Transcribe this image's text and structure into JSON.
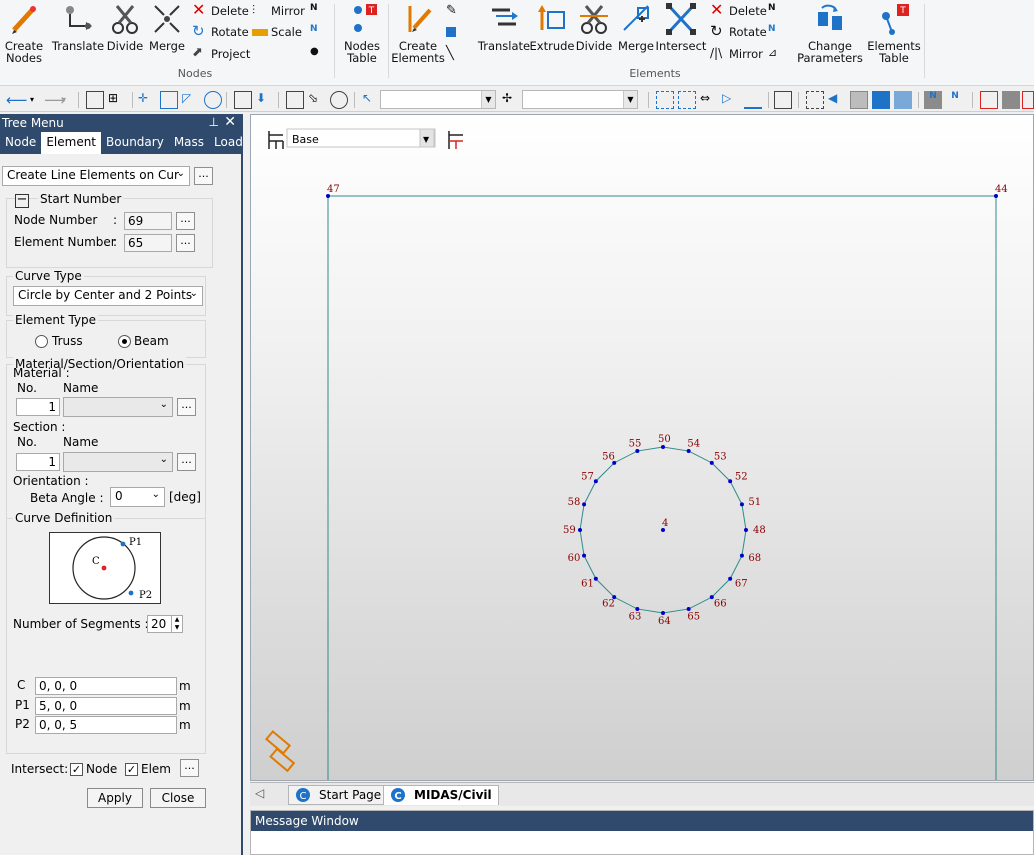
{
  "ribbon": {
    "nodes_group": {
      "label": "Nodes",
      "create_nodes": "Create\nNodes",
      "translate": "Translate",
      "divide": "Divide",
      "merge": "Merge",
      "delete": "Delete",
      "rotate": "Rotate",
      "project": "Project",
      "mirror": "Mirror",
      "scale": "Scale",
      "nodes_table": "Nodes\nTable"
    },
    "elements_group": {
      "label": "Elements",
      "create_elements": "Create\nElements",
      "translate": "Translate",
      "extrude": "Extrude",
      "divide": "Divide",
      "merge": "Merge",
      "intersect": "Intersect",
      "delete": "Delete",
      "rotate": "Rotate",
      "mirror": "Mirror",
      "change_parameters": "Change\nParameters",
      "elements_table": "Elements\nTable"
    }
  },
  "tree": {
    "title": "Tree Menu",
    "tabs": [
      "Node",
      "Element",
      "Boundary",
      "Mass",
      "Load"
    ],
    "active_tab": "Element",
    "command": "Create Line Elements on Cur",
    "start_number": {
      "legend": "Start Number",
      "node_label": "Node Number",
      "node_value": "69",
      "element_label": "Element Number",
      "element_value": "65"
    },
    "curve_type": {
      "legend": "Curve Type",
      "value": "Circle by Center and 2 Points"
    },
    "element_type": {
      "legend": "Element Type",
      "options": [
        "Truss",
        "Beam"
      ],
      "selected": "Beam"
    },
    "mso": {
      "legend": "Material/Section/Orientation",
      "material_label": "Material :",
      "section_label": "Section :",
      "no_header": "No.",
      "name_header": "Name",
      "material_no": "1",
      "section_no": "1",
      "orientation_label": "Orientation :",
      "beta_label": "Beta Angle :",
      "beta_value": "0",
      "beta_unit": "[deg]"
    },
    "curve_def": {
      "legend": "Curve Definition",
      "diagram_c": "C",
      "diagram_p1": "P1",
      "diagram_p2": "P2",
      "segments_label": "Number of Segments :",
      "segments_value": "20",
      "c_label": "C",
      "c_value": "0, 0, 0",
      "p1_label": "P1",
      "p1_value": "5, 0, 0",
      "p2_label": "P2",
      "p2_value": "0, 0, 5",
      "unit": "m"
    },
    "intersect": {
      "label": "Intersect:",
      "node": "Node",
      "elem": "Elem",
      "node_checked": true,
      "elem_checked": true
    },
    "apply": "Apply",
    "close": "Close"
  },
  "viewport": {
    "layer_combo": "Base",
    "corner_nodes": [
      "47",
      "44"
    ],
    "center_node": "4",
    "circle_nodes": [
      "48",
      "51",
      "52",
      "53",
      "54",
      "50",
      "55",
      "56",
      "57",
      "58",
      "59",
      "60",
      "61",
      "62",
      "63",
      "64",
      "65",
      "66",
      "67",
      "68"
    ]
  },
  "doc_tabs": [
    "Start Page",
    "MIDAS/Civil"
  ],
  "active_doc_tab": "MIDAS/Civil",
  "message_window": "Message Window",
  "colors": {
    "accent": "#2f4a6d",
    "node": "#0000cc",
    "label": "#8b0000",
    "line": "#2e8b8b"
  }
}
